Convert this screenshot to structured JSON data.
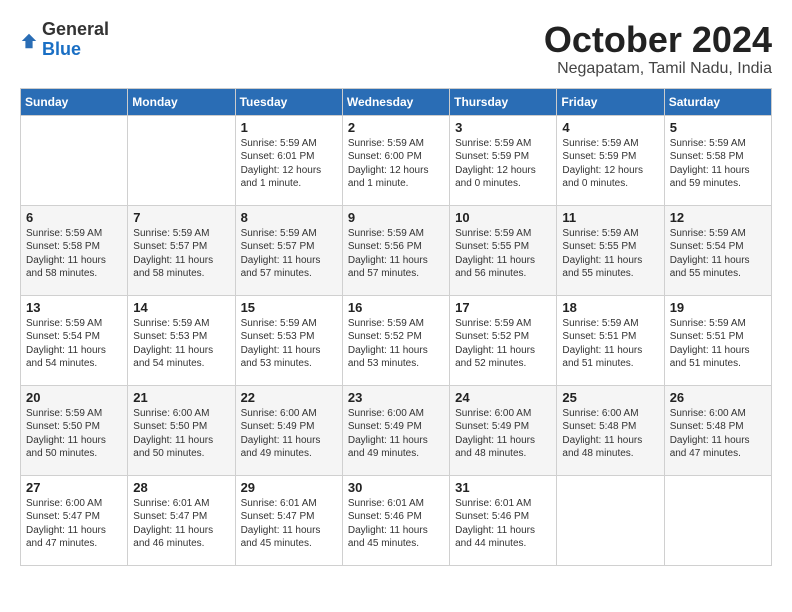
{
  "header": {
    "logo_general": "General",
    "logo_blue": "Blue",
    "month_title": "October 2024",
    "location": "Negapatam, Tamil Nadu, India"
  },
  "days_of_week": [
    "Sunday",
    "Monday",
    "Tuesday",
    "Wednesday",
    "Thursday",
    "Friday",
    "Saturday"
  ],
  "weeks": [
    [
      {
        "day": "",
        "content": ""
      },
      {
        "day": "",
        "content": ""
      },
      {
        "day": "1",
        "content": "Sunrise: 5:59 AM\nSunset: 6:01 PM\nDaylight: 12 hours\nand 1 minute."
      },
      {
        "day": "2",
        "content": "Sunrise: 5:59 AM\nSunset: 6:00 PM\nDaylight: 12 hours\nand 1 minute."
      },
      {
        "day": "3",
        "content": "Sunrise: 5:59 AM\nSunset: 5:59 PM\nDaylight: 12 hours\nand 0 minutes."
      },
      {
        "day": "4",
        "content": "Sunrise: 5:59 AM\nSunset: 5:59 PM\nDaylight: 12 hours\nand 0 minutes."
      },
      {
        "day": "5",
        "content": "Sunrise: 5:59 AM\nSunset: 5:58 PM\nDaylight: 11 hours\nand 59 minutes."
      }
    ],
    [
      {
        "day": "6",
        "content": "Sunrise: 5:59 AM\nSunset: 5:58 PM\nDaylight: 11 hours\nand 58 minutes."
      },
      {
        "day": "7",
        "content": "Sunrise: 5:59 AM\nSunset: 5:57 PM\nDaylight: 11 hours\nand 58 minutes."
      },
      {
        "day": "8",
        "content": "Sunrise: 5:59 AM\nSunset: 5:57 PM\nDaylight: 11 hours\nand 57 minutes."
      },
      {
        "day": "9",
        "content": "Sunrise: 5:59 AM\nSunset: 5:56 PM\nDaylight: 11 hours\nand 57 minutes."
      },
      {
        "day": "10",
        "content": "Sunrise: 5:59 AM\nSunset: 5:55 PM\nDaylight: 11 hours\nand 56 minutes."
      },
      {
        "day": "11",
        "content": "Sunrise: 5:59 AM\nSunset: 5:55 PM\nDaylight: 11 hours\nand 55 minutes."
      },
      {
        "day": "12",
        "content": "Sunrise: 5:59 AM\nSunset: 5:54 PM\nDaylight: 11 hours\nand 55 minutes."
      }
    ],
    [
      {
        "day": "13",
        "content": "Sunrise: 5:59 AM\nSunset: 5:54 PM\nDaylight: 11 hours\nand 54 minutes."
      },
      {
        "day": "14",
        "content": "Sunrise: 5:59 AM\nSunset: 5:53 PM\nDaylight: 11 hours\nand 54 minutes."
      },
      {
        "day": "15",
        "content": "Sunrise: 5:59 AM\nSunset: 5:53 PM\nDaylight: 11 hours\nand 53 minutes."
      },
      {
        "day": "16",
        "content": "Sunrise: 5:59 AM\nSunset: 5:52 PM\nDaylight: 11 hours\nand 53 minutes."
      },
      {
        "day": "17",
        "content": "Sunrise: 5:59 AM\nSunset: 5:52 PM\nDaylight: 11 hours\nand 52 minutes."
      },
      {
        "day": "18",
        "content": "Sunrise: 5:59 AM\nSunset: 5:51 PM\nDaylight: 11 hours\nand 51 minutes."
      },
      {
        "day": "19",
        "content": "Sunrise: 5:59 AM\nSunset: 5:51 PM\nDaylight: 11 hours\nand 51 minutes."
      }
    ],
    [
      {
        "day": "20",
        "content": "Sunrise: 5:59 AM\nSunset: 5:50 PM\nDaylight: 11 hours\nand 50 minutes."
      },
      {
        "day": "21",
        "content": "Sunrise: 6:00 AM\nSunset: 5:50 PM\nDaylight: 11 hours\nand 50 minutes."
      },
      {
        "day": "22",
        "content": "Sunrise: 6:00 AM\nSunset: 5:49 PM\nDaylight: 11 hours\nand 49 minutes."
      },
      {
        "day": "23",
        "content": "Sunrise: 6:00 AM\nSunset: 5:49 PM\nDaylight: 11 hours\nand 49 minutes."
      },
      {
        "day": "24",
        "content": "Sunrise: 6:00 AM\nSunset: 5:49 PM\nDaylight: 11 hours\nand 48 minutes."
      },
      {
        "day": "25",
        "content": "Sunrise: 6:00 AM\nSunset: 5:48 PM\nDaylight: 11 hours\nand 48 minutes."
      },
      {
        "day": "26",
        "content": "Sunrise: 6:00 AM\nSunset: 5:48 PM\nDaylight: 11 hours\nand 47 minutes."
      }
    ],
    [
      {
        "day": "27",
        "content": "Sunrise: 6:00 AM\nSunset: 5:47 PM\nDaylight: 11 hours\nand 47 minutes."
      },
      {
        "day": "28",
        "content": "Sunrise: 6:01 AM\nSunset: 5:47 PM\nDaylight: 11 hours\nand 46 minutes."
      },
      {
        "day": "29",
        "content": "Sunrise: 6:01 AM\nSunset: 5:47 PM\nDaylight: 11 hours\nand 45 minutes."
      },
      {
        "day": "30",
        "content": "Sunrise: 6:01 AM\nSunset: 5:46 PM\nDaylight: 11 hours\nand 45 minutes."
      },
      {
        "day": "31",
        "content": "Sunrise: 6:01 AM\nSunset: 5:46 PM\nDaylight: 11 hours\nand 44 minutes."
      },
      {
        "day": "",
        "content": ""
      },
      {
        "day": "",
        "content": ""
      }
    ]
  ]
}
